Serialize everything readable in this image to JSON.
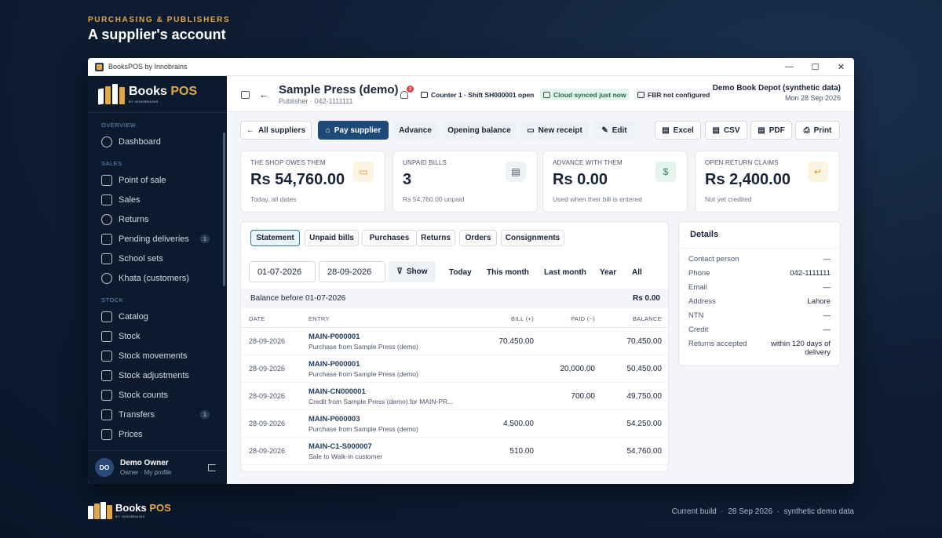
{
  "hero": {
    "eyebrow": "PURCHASING & PUBLISHERS",
    "title": "A supplier's account"
  },
  "window": {
    "title": "BooksPOS by Innobrains",
    "controls": [
      "—",
      "☐",
      "✕"
    ]
  },
  "brand": {
    "name_a": "Books",
    "name_b": "POS",
    "sub": "BY INNOBRAINS",
    "accent": "#e3a845",
    "navy": "#1f4a78"
  },
  "sidebar": {
    "sections": [
      {
        "label": "OVERVIEW",
        "items": [
          {
            "label": "Dashboard",
            "icon": "gauge-icon"
          }
        ]
      },
      {
        "label": "SALES",
        "items": [
          {
            "label": "Point of sale",
            "icon": "scan-icon"
          },
          {
            "label": "Sales",
            "icon": "receipt-icon"
          },
          {
            "label": "Returns",
            "icon": "refresh-icon"
          },
          {
            "label": "Pending deliveries",
            "icon": "hourglass-icon",
            "badge": "1"
          },
          {
            "label": "School sets",
            "icon": "school-icon"
          },
          {
            "label": "Khata (customers)",
            "icon": "users-icon"
          }
        ]
      },
      {
        "label": "STOCK",
        "items": [
          {
            "label": "Catalog",
            "icon": "book-icon"
          },
          {
            "label": "Stock",
            "icon": "box-icon"
          },
          {
            "label": "Stock movements",
            "icon": "arrows-icon"
          },
          {
            "label": "Stock adjustments",
            "icon": "sliders-icon"
          },
          {
            "label": "Stock counts",
            "icon": "clipboard-icon"
          },
          {
            "label": "Transfers",
            "icon": "truck-icon",
            "badge": "1"
          },
          {
            "label": "Prices",
            "icon": "tag-icon"
          }
        ]
      }
    ],
    "user": {
      "initials": "DO",
      "name": "Demo Owner",
      "role": "Owner · My profile"
    }
  },
  "header": {
    "title": "Sample Press (demo)",
    "subtitle": "Publisher · 042-1111111",
    "notifications": "3",
    "counter": "Counter 1 · Shift SH000001 open",
    "sync": "Cloud synced just now",
    "fbr": "FBR not configured",
    "store": "Demo Book Depot (synthetic data)",
    "date": "Mon 28 Sep 2026"
  },
  "toolbar": {
    "all_suppliers": "All suppliers",
    "pay_supplier": "Pay supplier",
    "advance": "Advance",
    "opening_balance": "Opening balance",
    "new_receipt": "New receipt",
    "edit": "Edit",
    "excel": "Excel",
    "csv": "CSV",
    "pdf": "PDF",
    "print": "Print"
  },
  "cards": [
    {
      "label": "THE SHOP OWES THEM",
      "value": "Rs 54,760.00",
      "sub": "Today, all dates",
      "icon": "wallet-icon",
      "color": "#fdf3e1"
    },
    {
      "label": "UNPAID BILLS",
      "value": "3",
      "sub": "Rs 54,760.00 unpaid",
      "icon": "document-icon",
      "color": "#eef1f5"
    },
    {
      "label": "ADVANCE WITH THEM",
      "value": "Rs 0.00",
      "sub": "Used when their bill is entered",
      "icon": "money-icon",
      "color": "#e3f5ec"
    },
    {
      "label": "OPEN RETURN CLAIMS",
      "value": "Rs 2,400.00",
      "sub": "Not yet credited",
      "icon": "return-icon",
      "color": "#fdf3e1"
    }
  ],
  "statement": {
    "tabs": [
      "Statement",
      "Unpaid bills",
      "Purchases",
      "Returns",
      "Orders",
      "Consignments"
    ],
    "from": "01-07-2026",
    "to": "28-09-2026",
    "show": "Show",
    "ranges": [
      "Today",
      "This month",
      "Last month",
      "Year",
      "All"
    ],
    "balance_before_label": "Balance before 01-07-2026",
    "balance_before_value": "Rs 0.00",
    "columns": [
      "DATE",
      "ENTRY",
      "BILL (+)",
      "PAID (−)",
      "BALANCE"
    ],
    "rows": [
      {
        "date": "28-09-2026",
        "id": "MAIN-P000001",
        "desc": "Purchase from Sample Press (demo)",
        "bill": "70,450.00",
        "paid": "",
        "balance": "70,450.00"
      },
      {
        "date": "28-09-2026",
        "id": "MAIN-P000001",
        "desc": "Purchase from Sample Press (demo)",
        "bill": "",
        "paid": "20,000.00",
        "balance": "50,450.00"
      },
      {
        "date": "28-09-2026",
        "id": "MAIN-CN000001",
        "desc": "Credit from Sample Press (demo) for MAIN-PR...",
        "bill": "",
        "paid": "700.00",
        "balance": "49,750.00"
      },
      {
        "date": "28-09-2026",
        "id": "MAIN-P000003",
        "desc": "Purchase from Sample Press (demo)",
        "bill": "4,500.00",
        "paid": "",
        "balance": "54,250.00"
      },
      {
        "date": "28-09-2026",
        "id": "MAIN-C1-S000007",
        "desc": "Sale to Walk-in customer",
        "bill": "510.00",
        "paid": "",
        "balance": "54,760.00"
      }
    ]
  },
  "details": {
    "title": "Details",
    "rows": [
      {
        "label": "Contact person",
        "value": "—"
      },
      {
        "label": "Phone",
        "value": "042-1111111"
      },
      {
        "label": "Email",
        "value": "—"
      },
      {
        "label": "Address",
        "value": "Lahore"
      },
      {
        "label": "NTN",
        "value": "—"
      },
      {
        "label": "Credit",
        "value": "—"
      },
      {
        "label": "Returns accepted",
        "value": "within 120 days of delivery"
      }
    ]
  },
  "footer": {
    "build_label": "Current build",
    "build_date": "28 Sep 2026",
    "note": "synthetic demo data"
  }
}
